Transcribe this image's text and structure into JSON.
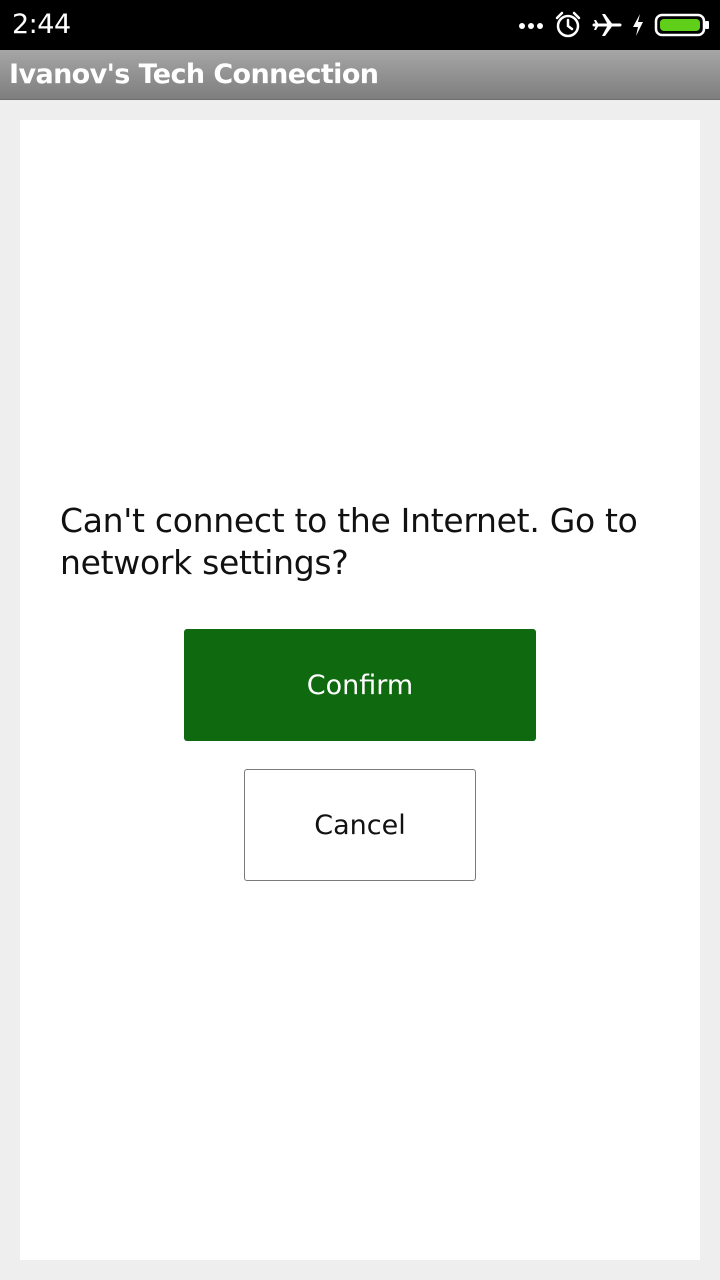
{
  "status_bar": {
    "time": "2:44",
    "icons": [
      "more-dots-icon",
      "alarm-icon",
      "airplane-mode-icon",
      "charging-bolt-icon",
      "battery-icon"
    ],
    "battery_color": "#5fcf1a"
  },
  "app": {
    "title": "Ivanov's Tech Connection"
  },
  "dialog": {
    "message": "Can't connect to the Internet. Go to network settings?",
    "confirm_label": "Confirm",
    "cancel_label": "Cancel",
    "confirm_color": "#0f6a0f"
  }
}
